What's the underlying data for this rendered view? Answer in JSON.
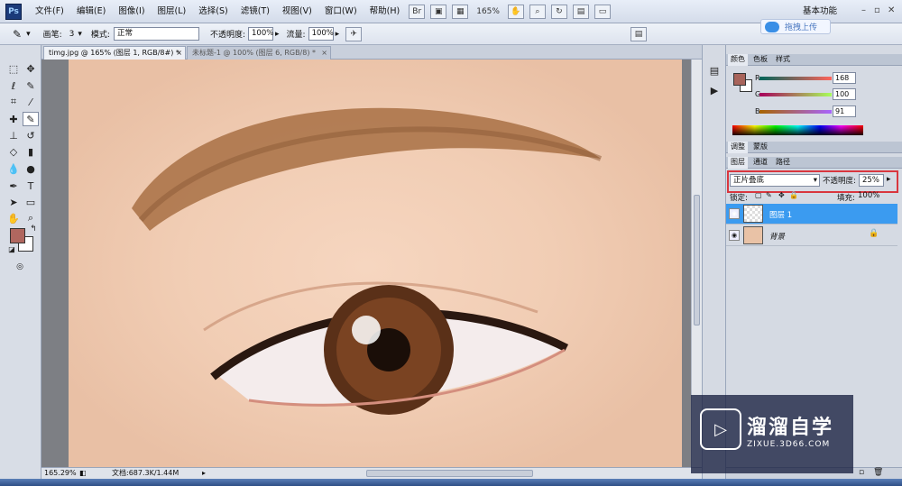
{
  "app": {
    "logo": "Ps",
    "workspace": "基本功能",
    "zoom": "165%"
  },
  "menu": [
    "文件(F)",
    "编辑(E)",
    "图像(I)",
    "图层(L)",
    "选择(S)",
    "滤镜(T)",
    "视图(V)",
    "窗口(W)",
    "帮助(H)"
  ],
  "upload_button": "拖拽上传",
  "options": {
    "brush_label": "画笔:",
    "brush_size": "3",
    "mode_label": "模式:",
    "mode_value": "正常",
    "opacity_label": "不透明度:",
    "opacity_value": "100%",
    "flow_label": "流量:",
    "flow_value": "100%"
  },
  "tabs": [
    {
      "label": "timg.jpg @ 165% (图层 1, RGB/8#) *",
      "close": "×"
    },
    {
      "label": "未标题-1 @ 100% (图层 6, RGB/8) *",
      "close": "×"
    }
  ],
  "status": {
    "zoom": "165.29%",
    "doc": "文档:687.3K/1.44M"
  },
  "color_panel": {
    "tabs": [
      "颜色",
      "色板",
      "样式"
    ],
    "r_label": "R",
    "r_value": "168",
    "g_label": "G",
    "g_value": "100",
    "b_label": "B",
    "b_value": "91",
    "fg_color": "#a8645b"
  },
  "adjust_tabs": [
    "调整",
    "蒙版"
  ],
  "layers_panel": {
    "tabs": [
      "图层",
      "通道",
      "路径"
    ],
    "blend_mode": "正片叠底",
    "opacity_label": "不透明度:",
    "opacity_value": "25%",
    "lock_label": "锁定:",
    "fill_label": "填充:",
    "fill_value": "100%",
    "layers": [
      {
        "name": "图层 1",
        "selected": true
      },
      {
        "name": "背景",
        "locked": true
      }
    ]
  },
  "watermark": {
    "title": "溜溜自学",
    "url": "ZIXUE.3D66.COM"
  },
  "colors": {
    "accent_selected": "#3b9bf0",
    "highlight_box": "#d9363e"
  }
}
